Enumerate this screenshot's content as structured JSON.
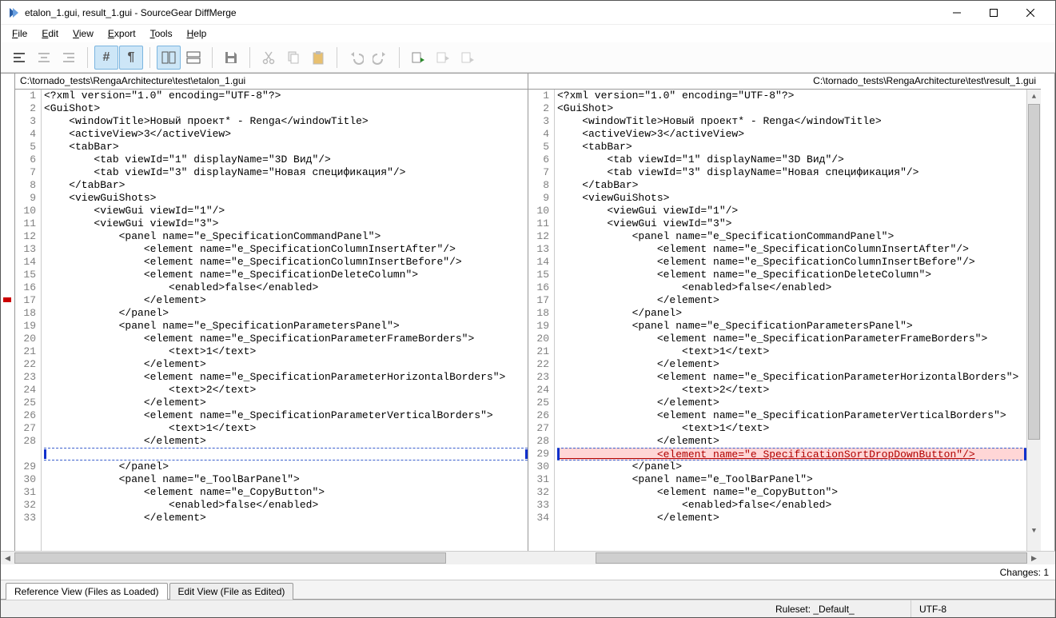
{
  "window": {
    "title": "etalon_1.gui, result_1.gui - SourceGear DiffMerge"
  },
  "menu": {
    "items": [
      "File",
      "Edit",
      "View",
      "Export",
      "Tools",
      "Help"
    ]
  },
  "toolbar": {
    "groups": [
      {
        "buttons": [
          {
            "name": "align-left-icon",
            "active": false
          },
          {
            "name": "align-center-icon",
            "active": false,
            "disabled": true
          },
          {
            "name": "align-right-icon",
            "active": false,
            "disabled": true
          }
        ]
      },
      {
        "buttons": [
          {
            "name": "hash-icon",
            "active": true,
            "glyph": "#"
          },
          {
            "name": "pilcrow-icon",
            "active": true,
            "glyph": "¶"
          }
        ]
      },
      {
        "buttons": [
          {
            "name": "split-vertical-icon",
            "active": true
          },
          {
            "name": "split-horizontal-icon",
            "active": false
          }
        ]
      },
      {
        "buttons": [
          {
            "name": "save-icon",
            "active": false
          }
        ]
      },
      {
        "buttons": [
          {
            "name": "cut-icon",
            "active": false,
            "disabled": true
          },
          {
            "name": "copy-icon",
            "active": false,
            "disabled": true
          },
          {
            "name": "paste-icon",
            "active": false,
            "disabled": true
          }
        ]
      },
      {
        "buttons": [
          {
            "name": "undo-icon",
            "active": false,
            "disabled": true
          },
          {
            "name": "redo-icon",
            "active": false,
            "disabled": true
          }
        ]
      },
      {
        "buttons": [
          {
            "name": "next-diff-icon",
            "active": false
          },
          {
            "name": "prev-diff-icon",
            "active": false,
            "disabled": true
          },
          {
            "name": "last-diff-icon",
            "active": false,
            "disabled": true
          }
        ]
      }
    ]
  },
  "panes": {
    "left": {
      "path": "C:\\tornado_tests\\RengaArchitecture\\test\\etalon_1.gui",
      "lines": [
        {
          "n": 1,
          "t": "<?xml version=\"1.0\" encoding=\"UTF-8\"?>"
        },
        {
          "n": 2,
          "t": "<GuiShot>"
        },
        {
          "n": 3,
          "t": "    <windowTitle>Новый проект* - Renga</windowTitle>"
        },
        {
          "n": 4,
          "t": "    <activeView>3</activeView>"
        },
        {
          "n": 5,
          "t": "    <tabBar>"
        },
        {
          "n": 6,
          "t": "        <tab viewId=\"1\" displayName=\"3D Вид\"/>"
        },
        {
          "n": 7,
          "t": "        <tab viewId=\"3\" displayName=\"Новая спецификация\"/>"
        },
        {
          "n": 8,
          "t": "    </tabBar>"
        },
        {
          "n": 9,
          "t": "    <viewGuiShots>"
        },
        {
          "n": 10,
          "t": "        <viewGui viewId=\"1\"/>"
        },
        {
          "n": 11,
          "t": "        <viewGui viewId=\"3\">"
        },
        {
          "n": 12,
          "t": "            <panel name=\"e_SpecificationCommandPanel\">"
        },
        {
          "n": 13,
          "t": "                <element name=\"e_SpecificationColumnInsertAfter\"/>"
        },
        {
          "n": 14,
          "t": "                <element name=\"e_SpecificationColumnInsertBefore\"/>"
        },
        {
          "n": 15,
          "t": "                <element name=\"e_SpecificationDeleteColumn\">"
        },
        {
          "n": 16,
          "t": "                    <enabled>false</enabled>"
        },
        {
          "n": 17,
          "t": "                </element>"
        },
        {
          "n": 18,
          "t": "            </panel>"
        },
        {
          "n": 19,
          "t": "            <panel name=\"e_SpecificationParametersPanel\">"
        },
        {
          "n": 20,
          "t": "                <element name=\"e_SpecificationParameterFrameBorders\">"
        },
        {
          "n": 21,
          "t": "                    <text>1</text>"
        },
        {
          "n": 22,
          "t": "                </element>"
        },
        {
          "n": 23,
          "t": "                <element name=\"e_SpecificationParameterHorizontalBorders\">"
        },
        {
          "n": 24,
          "t": "                    <text>2</text>"
        },
        {
          "n": 25,
          "t": "                </element>"
        },
        {
          "n": 26,
          "t": "                <element name=\"e_SpecificationParameterVerticalBorders\">"
        },
        {
          "n": 27,
          "t": "                    <text>1</text>"
        },
        {
          "n": 28,
          "t": "                </element>"
        },
        {
          "n": "",
          "t": "",
          "gap": true
        },
        {
          "n": 29,
          "t": "            </panel>"
        },
        {
          "n": 30,
          "t": "            <panel name=\"e_ToolBarPanel\">"
        },
        {
          "n": 31,
          "t": "                <element name=\"e_CopyButton\">"
        },
        {
          "n": 32,
          "t": "                    <enabled>false</enabled>"
        },
        {
          "n": 33,
          "t": "                </element>"
        }
      ]
    },
    "right": {
      "path": "C:\\tornado_tests\\RengaArchitecture\\test\\result_1.gui",
      "lines": [
        {
          "n": 1,
          "t": "<?xml version=\"1.0\" encoding=\"UTF-8\"?>"
        },
        {
          "n": 2,
          "t": "<GuiShot>"
        },
        {
          "n": 3,
          "t": "    <windowTitle>Новый проект* - Renga</windowTitle>"
        },
        {
          "n": 4,
          "t": "    <activeView>3</activeView>"
        },
        {
          "n": 5,
          "t": "    <tabBar>"
        },
        {
          "n": 6,
          "t": "        <tab viewId=\"1\" displayName=\"3D Вид\"/>"
        },
        {
          "n": 7,
          "t": "        <tab viewId=\"3\" displayName=\"Новая спецификация\"/>"
        },
        {
          "n": 8,
          "t": "    </tabBar>"
        },
        {
          "n": 9,
          "t": "    <viewGuiShots>"
        },
        {
          "n": 10,
          "t": "        <viewGui viewId=\"1\"/>"
        },
        {
          "n": 11,
          "t": "        <viewGui viewId=\"3\">"
        },
        {
          "n": 12,
          "t": "            <panel name=\"e_SpecificationCommandPanel\">"
        },
        {
          "n": 13,
          "t": "                <element name=\"e_SpecificationColumnInsertAfter\"/>"
        },
        {
          "n": 14,
          "t": "                <element name=\"e_SpecificationColumnInsertBefore\"/>"
        },
        {
          "n": 15,
          "t": "                <element name=\"e_SpecificationDeleteColumn\">"
        },
        {
          "n": 16,
          "t": "                    <enabled>false</enabled>"
        },
        {
          "n": 17,
          "t": "                </element>"
        },
        {
          "n": 18,
          "t": "            </panel>"
        },
        {
          "n": 19,
          "t": "            <panel name=\"e_SpecificationParametersPanel\">"
        },
        {
          "n": 20,
          "t": "                <element name=\"e_SpecificationParameterFrameBorders\">"
        },
        {
          "n": 21,
          "t": "                    <text>1</text>"
        },
        {
          "n": 22,
          "t": "                </element>"
        },
        {
          "n": 23,
          "t": "                <element name=\"e_SpecificationParameterHorizontalBorders\">"
        },
        {
          "n": 24,
          "t": "                    <text>2</text>"
        },
        {
          "n": 25,
          "t": "                </element>"
        },
        {
          "n": 26,
          "t": "                <element name=\"e_SpecificationParameterVerticalBorders\">"
        },
        {
          "n": 27,
          "t": "                    <text>1</text>"
        },
        {
          "n": 28,
          "t": "                </element>"
        },
        {
          "n": 29,
          "t": "                <element name=\"e_SpecificationSortDropDownButton\"/>",
          "ins": true
        },
        {
          "n": 30,
          "t": "            </panel>"
        },
        {
          "n": 31,
          "t": "            <panel name=\"e_ToolBarPanel\">"
        },
        {
          "n": 32,
          "t": "                <element name=\"e_CopyButton\">"
        },
        {
          "n": 33,
          "t": "                    <enabled>false</enabled>"
        },
        {
          "n": 34,
          "t": "                </element>"
        }
      ]
    }
  },
  "footer": {
    "changes_label": "Changes: 1"
  },
  "viewtabs": {
    "ref": "Reference View (Files as Loaded)",
    "edit": "Edit View (File as Edited)"
  },
  "status": {
    "ruleset": "Ruleset: _Default_",
    "encoding": "UTF-8"
  }
}
